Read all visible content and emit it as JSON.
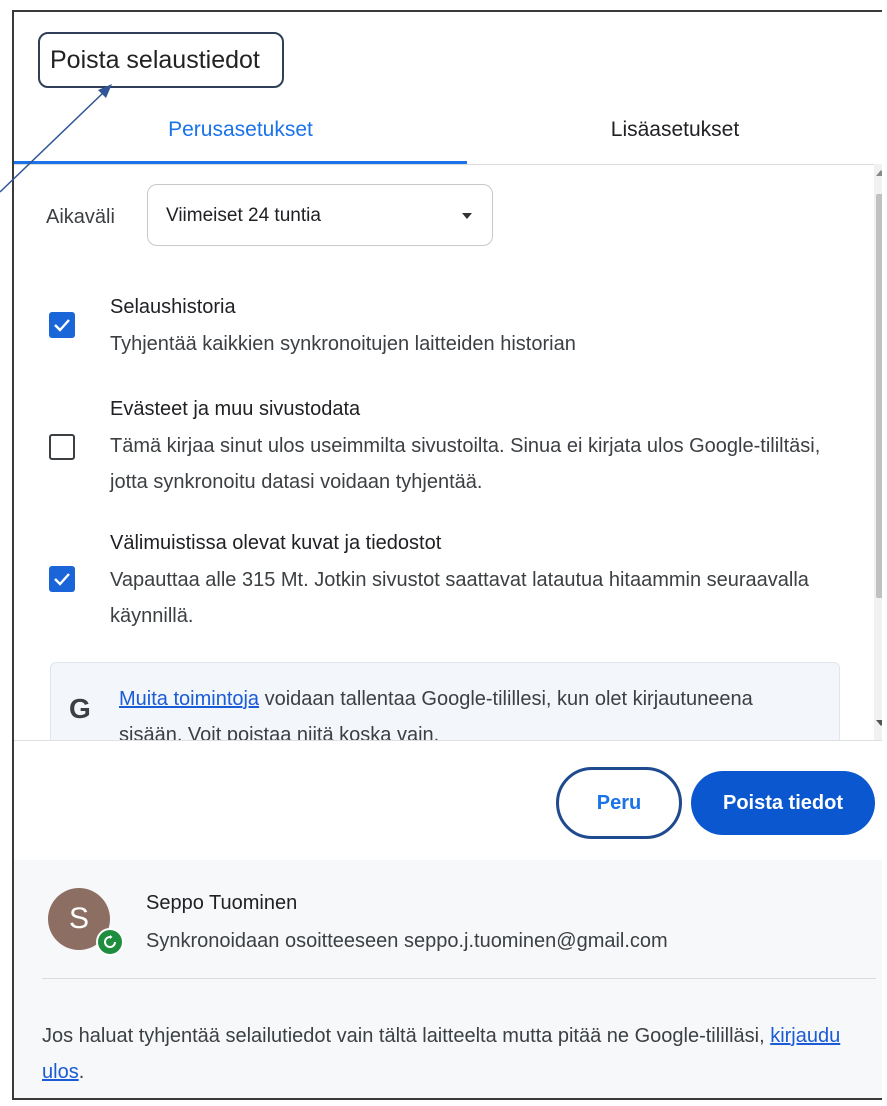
{
  "dialog": {
    "title": "Poista selaustiedot"
  },
  "tabs": [
    {
      "label": "Perusasetukset",
      "active": true
    },
    {
      "label": "Lisäasetukset",
      "active": false
    }
  ],
  "time_range": {
    "label": "Aikaväli",
    "selected": "Viimeiset 24 tuntia"
  },
  "options": [
    {
      "title": "Selaushistoria",
      "description": "Tyhjentää kaikkien synkronoitujen laitteiden historian",
      "checked": true
    },
    {
      "title": "Evästeet ja muu sivustodata",
      "description": "Tämä kirjaa sinut ulos useimmilta sivustoilta. Sinua ei kirjata ulos Google-tililtäsi, jotta synkronoitu datasi voidaan tyhjentää.",
      "checked": false
    },
    {
      "title": "Välimuistissa olevat kuvat ja tiedostot",
      "description": "Vapauttaa alle 315 Mt. Jotkin sivustot saattavat latautua hitaammin seuraavalla käynnillä.",
      "checked": true
    }
  ],
  "info": {
    "icon": "google-g-icon",
    "link_text": "Muita toimintoja",
    "text": " voidaan tallentaa Google-tilillesi, kun olet kirjautuneena sisään. Voit poistaa niitä koska vain."
  },
  "buttons": {
    "cancel": "Peru",
    "delete": "Poista tiedot"
  },
  "account": {
    "avatar_letter": "S",
    "name": "Seppo Tuominen",
    "sync_text": "Synkronoidaan osoitteeseen seppo.j.tuominen@gmail.com"
  },
  "footer": {
    "text": "Jos haluat tyhjentää selailutiedot vain tältä laitteelta mutta pitää ne Google-tililläsi, ",
    "link": "kirjaudu ulos",
    "suffix": "."
  },
  "colors": {
    "accent": "#1a73e8",
    "primary_button": "#0b57d0",
    "checkbox": "#1a66d8",
    "sync_badge": "#1e8e3e",
    "avatar": "#8d6e63"
  }
}
